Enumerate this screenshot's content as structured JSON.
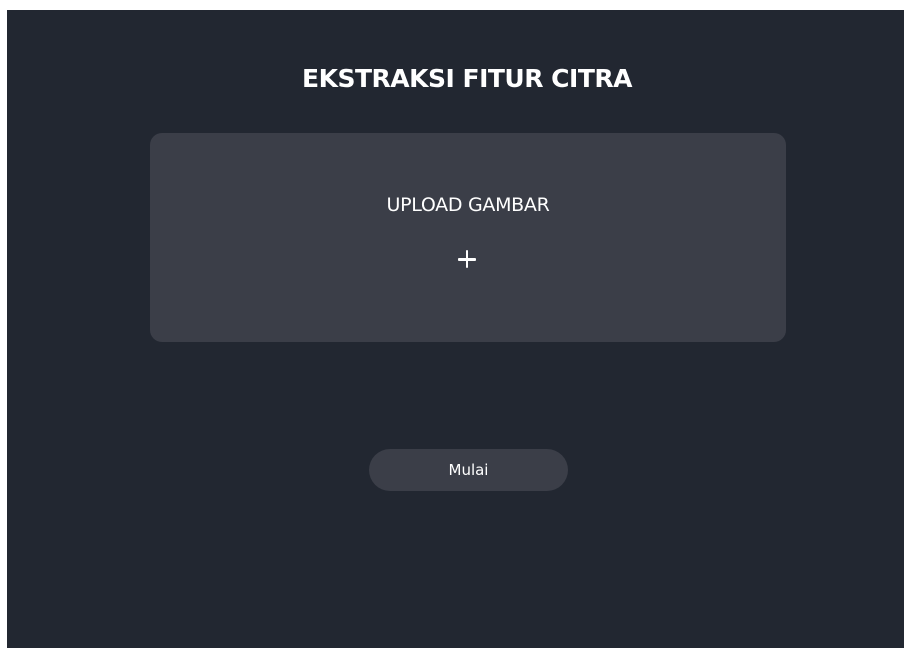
{
  "app": {
    "title": "EKSTRAKSI FITUR CITRA"
  },
  "upload": {
    "label": "UPLOAD GAMBAR",
    "icon": "plus-icon"
  },
  "actions": {
    "start_label": "Mulai"
  },
  "colors": {
    "background": "#222731",
    "panel": "#3b3e48",
    "text": "#ffffff"
  }
}
